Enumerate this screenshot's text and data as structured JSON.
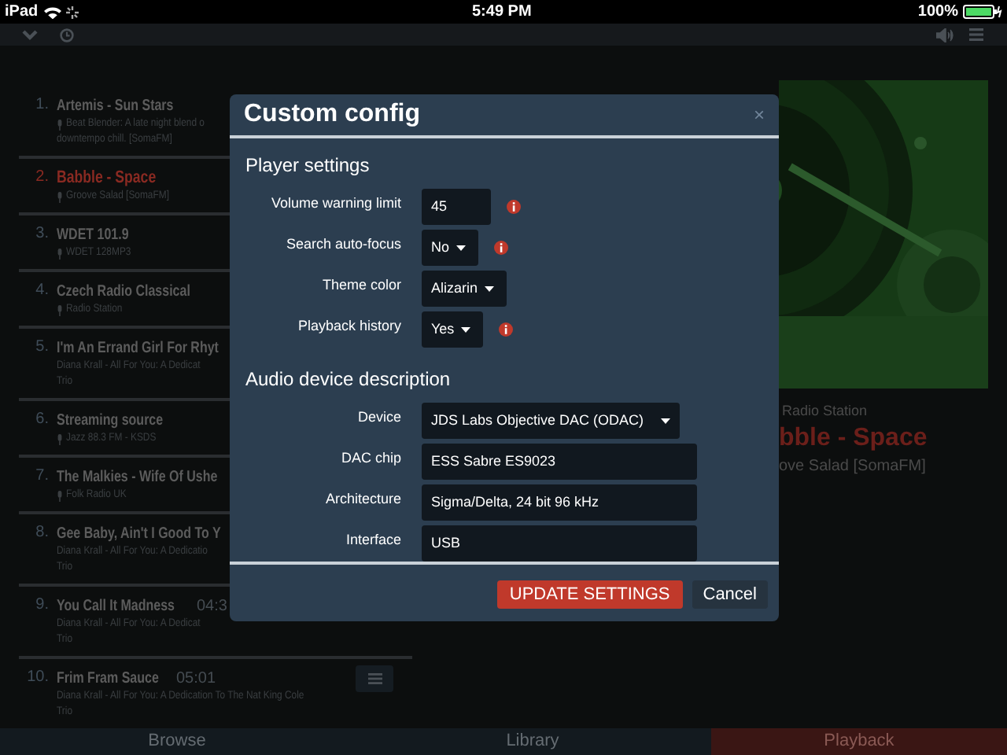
{
  "status_bar": {
    "carrier": "iPad",
    "time": "5:49 PM",
    "battery": "100%"
  },
  "playlist": {
    "items": [
      {
        "number": "1.",
        "title": "Artemis - Sun Stars",
        "kind": "stream",
        "playing": false,
        "menu": false,
        "lines": [
          "Beat Blender: A late night blend o",
          "downtempo chill. [SomaFM]"
        ]
      },
      {
        "number": "2.",
        "title": "Babble - Space",
        "kind": "stream",
        "playing": true,
        "menu": false,
        "lines": [
          "Groove Salad [SomaFM]"
        ]
      },
      {
        "number": "3.",
        "title": "WDET 101.9",
        "kind": "stream",
        "playing": false,
        "menu": false,
        "lines": [
          "WDET 128MP3"
        ]
      },
      {
        "number": "4.",
        "title": "Czech Radio Classical",
        "kind": "stream",
        "playing": false,
        "menu": false,
        "lines": [
          "Radio Station"
        ]
      },
      {
        "number": "5.",
        "title": "I'm An Errand Girl For Rhyt",
        "kind": "track",
        "playing": false,
        "menu": false,
        "lines": [
          "Diana Krall - All For You: A Dedicat",
          "Trio"
        ]
      },
      {
        "number": "6.",
        "title": "Streaming source",
        "kind": "stream",
        "playing": false,
        "menu": false,
        "lines": [
          "Jazz 88.3 FM - KSDS"
        ]
      },
      {
        "number": "7.",
        "title": "The Malkies - Wife Of Ushe",
        "kind": "stream",
        "playing": false,
        "menu": false,
        "lines": [
          "Folk Radio UK"
        ]
      },
      {
        "number": "8.",
        "title": "Gee Baby, Ain't I Good To Y",
        "kind": "track",
        "playing": false,
        "menu": false,
        "lines": [
          "Diana Krall - All For You: A Dedicatio",
          "Trio"
        ]
      },
      {
        "number": "9.",
        "title": "You Call It Madness",
        "duration": "04:3",
        "kind": "track",
        "playing": false,
        "menu": false,
        "lines": [
          "Diana Krall - All For You: A Dedicat",
          "Trio"
        ]
      },
      {
        "number": "10.",
        "title": "Frim Fram Sauce",
        "duration": "05:01",
        "kind": "track",
        "playing": false,
        "menu": true,
        "lines": [
          "Diana Krall - All For You: A Dedication To The Nat King Cole",
          "Trio"
        ]
      }
    ]
  },
  "now_playing": {
    "kind": "picture",
    "subtitle": "Radio Station",
    "title": "bble - Space",
    "station": "ove Salad [SomaFM]"
  },
  "dialog": {
    "title": "Custom config",
    "close": "×",
    "sections": [
      {
        "heading": "Player settings",
        "fields": [
          {
            "label": "Volume warning limit",
            "kind": "text",
            "value": "45",
            "info": true
          },
          {
            "label": "Search auto-focus",
            "kind": "select",
            "value": "No",
            "info": true
          },
          {
            "label": "Theme color",
            "kind": "select",
            "value": "Alizarin",
            "info": false
          },
          {
            "label": "Playback history",
            "kind": "select",
            "value": "Yes",
            "info": true
          }
        ]
      },
      {
        "heading": "Audio device description",
        "fields": [
          {
            "label": "Device",
            "kind": "select",
            "value": "JDS Labs Objective DAC (ODAC)",
            "info": false
          },
          {
            "label": "DAC chip",
            "kind": "text",
            "value": "ESS Sabre ES9023",
            "info": false
          },
          {
            "label": "Architecture",
            "kind": "text",
            "value": "Sigma/Delta, 24 bit 96 kHz",
            "info": false
          },
          {
            "label": "Interface",
            "kind": "text",
            "value": "USB",
            "info": false
          }
        ]
      }
    ],
    "buttons": [
      {
        "label": "UPDATE SETTINGS",
        "kind": "primary"
      },
      {
        "label": "Cancel",
        "kind": "secondary"
      }
    ]
  },
  "tabs": [
    {
      "label": "Browse",
      "selected": false
    },
    {
      "label": "Library",
      "selected": false
    },
    {
      "label": "Playback",
      "selected": true
    }
  ]
}
